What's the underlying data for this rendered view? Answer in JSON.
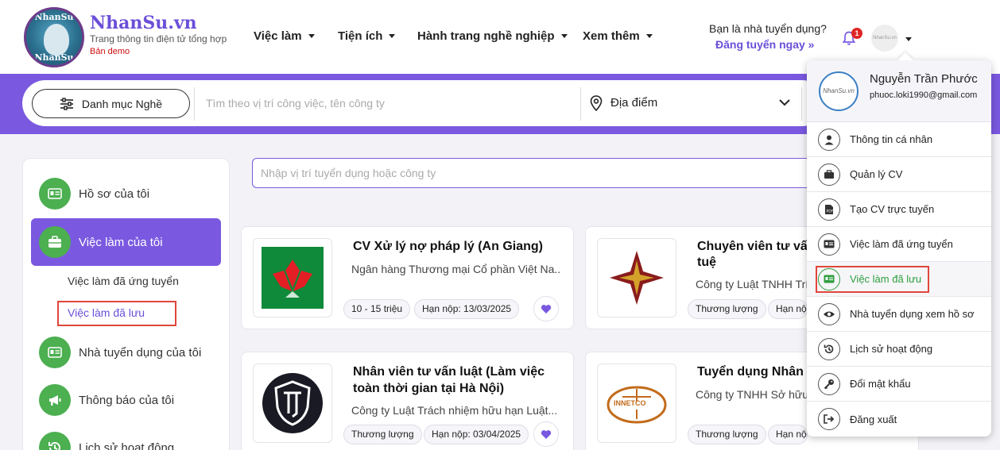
{
  "brand": {
    "name": "NhanSu.vn",
    "logo_text_top": "NhanSu",
    "logo_text_bottom": "NhanSu",
    "tagline": "Trang thông tin điện tử tổng hợp",
    "demo": "Bản demo"
  },
  "nav": [
    {
      "label": "Việc làm"
    },
    {
      "label": "Tiện ích"
    },
    {
      "label": "Hành trang nghề nghiệp"
    },
    {
      "label": "Xem thêm"
    }
  ],
  "recruiter": {
    "question": "Bạn là nhà tuyển dụng?",
    "cta": "Đăng tuyển ngay »"
  },
  "notifications": {
    "count": "1"
  },
  "avatar_text": "NhanSu.vn",
  "search": {
    "category_button": "Danh mục Nghề",
    "placeholder": "Tìm theo vị trí công việc, tên công ty",
    "location": "Địa điểm"
  },
  "sidebar": {
    "items": [
      {
        "label": "Hồ sơ của tôi"
      },
      {
        "label": "Việc làm của tôi"
      },
      {
        "label": "Nhà tuyển dụng của tôi"
      },
      {
        "label": "Thông báo của tôi"
      },
      {
        "label": "Lịch sử hoạt động"
      }
    ],
    "sub_items": [
      {
        "label": "Việc làm đã ứng tuyển"
      },
      {
        "label": "Việc làm đã lưu"
      }
    ]
  },
  "content": {
    "search_placeholder": "Nhập vị trí tuyển dụng hoặc công ty"
  },
  "jobs": [
    {
      "title": "CV Xử lý nợ pháp lý (An Giang)",
      "company": "Ngân hàng Thương mại Cổ phần Việt Na...",
      "salary": "10 - 15 triệu",
      "deadline": "Hạn nộp: 13/03/2025"
    },
    {
      "title": "Chuyên viên tư vấn",
      "title_line2": "tuệ",
      "company": "Công ty Luật TNHH Trí",
      "salary": "Thương lượng",
      "deadline": "Hạn nộ"
    },
    {
      "title": "Nhân viên tư vấn luật (Làm việc",
      "title_line2": "toàn thời gian tại Hà Nội)",
      "company": "Công ty Luật Trách nhiệm hữu hạn Luật...",
      "salary": "Thương lượng",
      "deadline": "Hạn nộp: 03/04/2025"
    },
    {
      "title": "Tuyển dụng Nhân v",
      "company": "Công ty TNHH Sở hữu",
      "salary": "Thương lượng",
      "deadline": "Hạn nộ",
      "logo_text": "INNETCO"
    }
  ],
  "dropdown": {
    "user_name": "Nguyễn Trần Phước",
    "email": "phuoc.loki1990@gmail.com",
    "items": [
      {
        "label": "Thông tin cá nhân"
      },
      {
        "label": "Quản lý CV"
      },
      {
        "label": "Tạo CV trực tuyến"
      },
      {
        "label": "Việc làm đã ứng tuyển"
      },
      {
        "label": "Việc làm đã lưu"
      },
      {
        "label": "Nhà tuyển dụng xem hồ sơ"
      },
      {
        "label": "Lịch sử hoạt động"
      },
      {
        "label": "Đổi mật khẩu"
      },
      {
        "label": "Đăng xuất"
      }
    ]
  },
  "colors": {
    "primary": "#7a59e0",
    "green": "#4caf50",
    "highlight_box": "#e0463c",
    "badge": "#e02525"
  }
}
